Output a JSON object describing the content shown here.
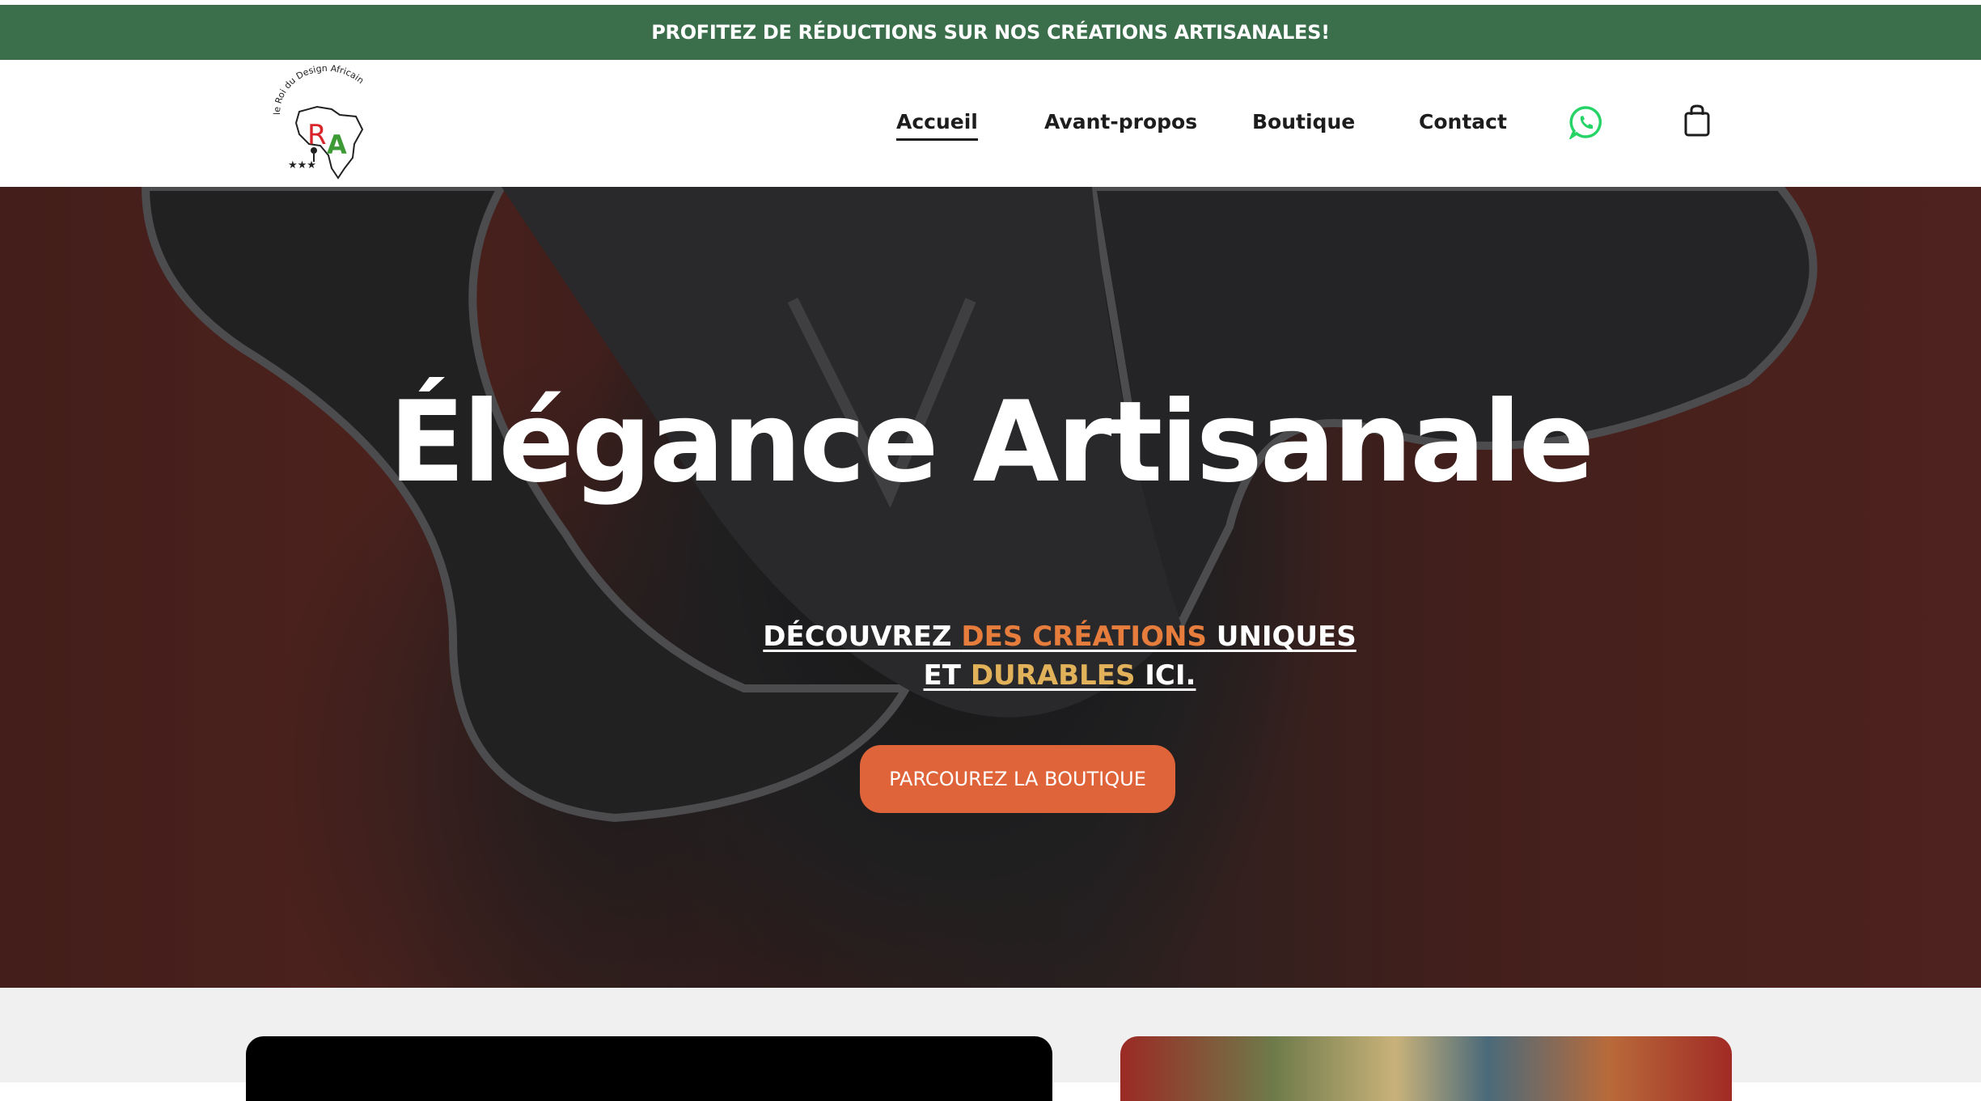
{
  "promo": {
    "text": "PROFITEZ DE RÉDUCTIONS SUR NOS CRÉATIONS ARTISANALES!"
  },
  "header": {
    "logo": {
      "arc_text": "le Roi du Design Africain",
      "letter_r": "R",
      "letter_a": "A",
      "stars": "★★★"
    },
    "nav": [
      {
        "label": "Accueil",
        "active": true
      },
      {
        "label": "Avant-propos",
        "active": false
      },
      {
        "label": "Boutique",
        "active": false
      },
      {
        "label": "Contact",
        "active": false
      }
    ],
    "icons": {
      "whatsapp": "whatsapp-icon",
      "cart": "shopping-bag-icon"
    }
  },
  "hero": {
    "title": "Élégance Artisanale",
    "subtitle": {
      "part1": "DÉCOUVREZ ",
      "part2": "DES CRÉATIONS",
      "part3": " UNIQUES ",
      "part4": "ET ",
      "part5": "DURABLES",
      "part6": " ICI."
    },
    "cta_label": "PARCOUREZ LA BOUTIQUE"
  },
  "colors": {
    "promo_bg": "#3b6e4b",
    "accent_orange": "#e0643a",
    "highlight_orange": "#e67d3c",
    "highlight_gold": "#e2b25a",
    "whatsapp_green": "#25d366"
  }
}
